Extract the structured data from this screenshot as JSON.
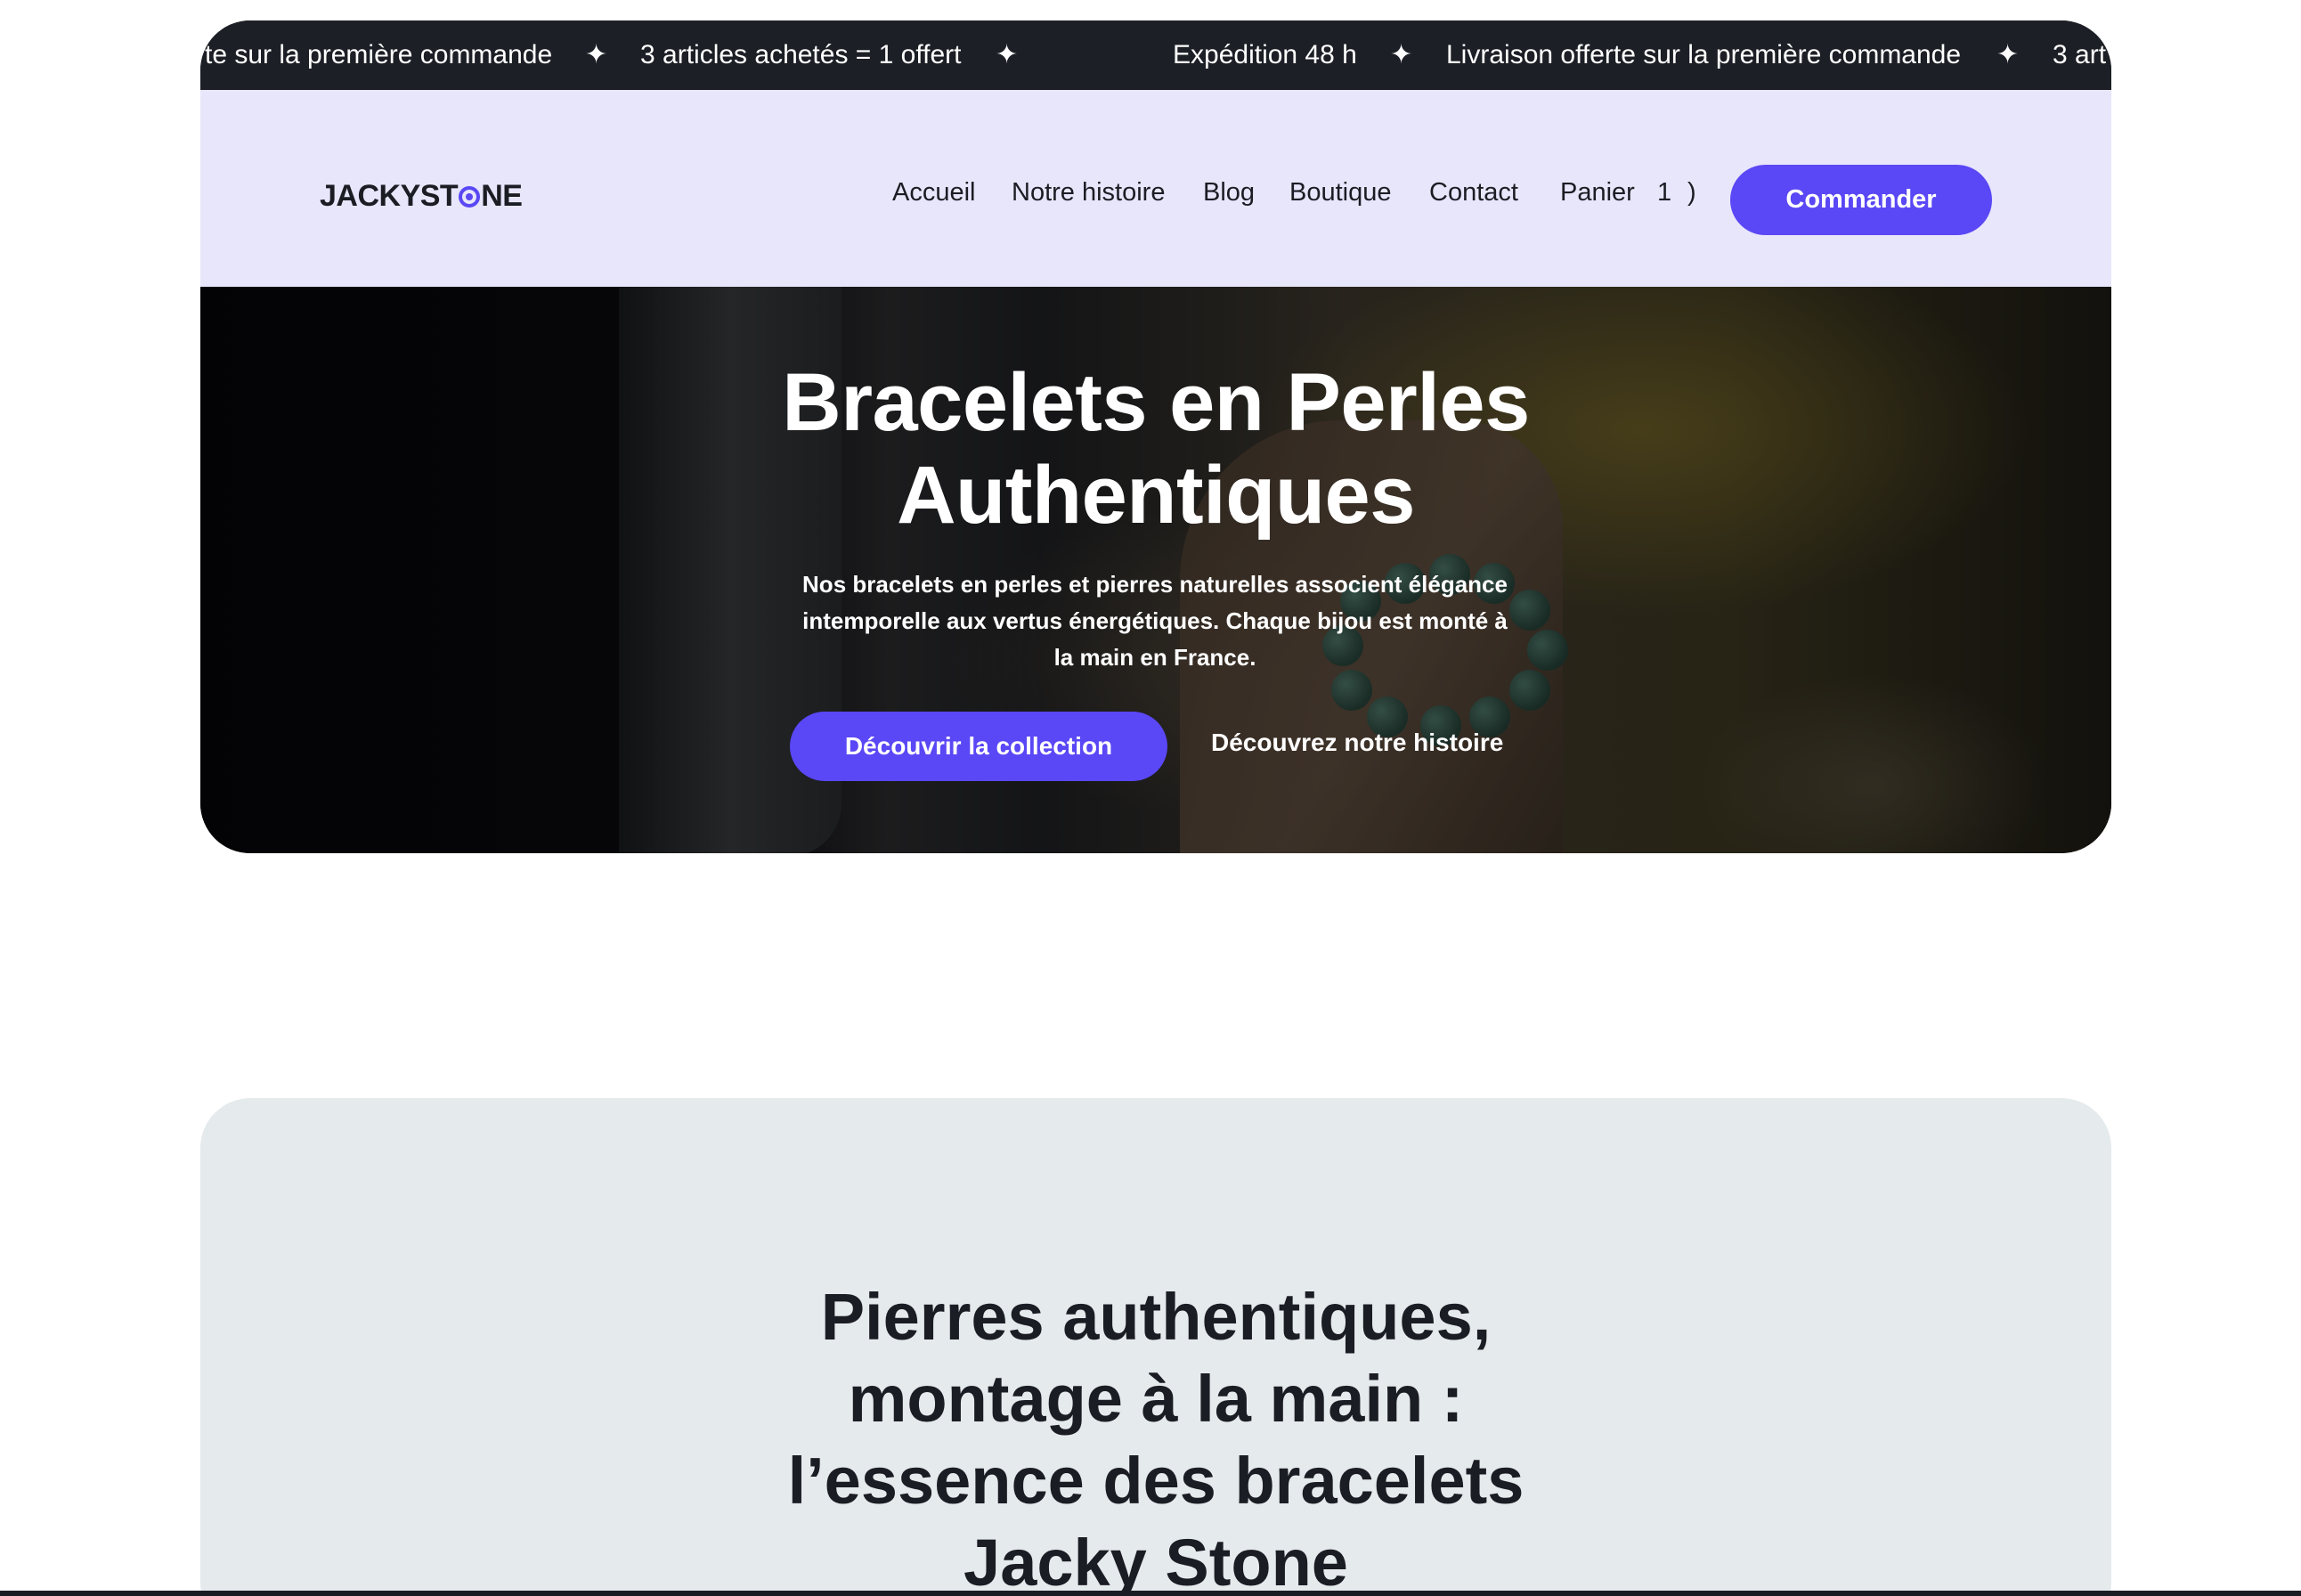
{
  "announcement": {
    "items": [
      "te sur la première commande",
      "3 articles achetés = 1 offert",
      "Expédition 48 h",
      "Livraison offerte sur la première commande",
      "3 art"
    ],
    "separator_icon": "sparkle-icon",
    "separator_glyph": "✦"
  },
  "header": {
    "logo_before": "JACKYST",
    "logo_after": "NE",
    "nav": [
      "Accueil",
      "Notre histoire",
      "Blog",
      "Boutique",
      "Contact",
      "Panier"
    ],
    "cart_count": "1",
    "cart_paren": ")",
    "cta_label": "Commander"
  },
  "hero": {
    "title_line1": "Bracelets en Perles",
    "title_line2": "Authentiques",
    "text_line1": "Nos bracelets en perles et pierres naturelles associent élégance",
    "text_line2": "intemporelle aux vertus énergétiques. Chaque bijou est monté à",
    "text_line3": "la main en France.",
    "primary_button": "Découvrir la collection",
    "secondary_link": "Découvrez notre histoire"
  },
  "section2": {
    "title_line1": "Pierres authentiques,",
    "title_line2": "montage à la main :",
    "title_line3": "l’essence des bracelets",
    "title_line4": "Jacky Stone"
  },
  "colors": {
    "accent": "#5a47f5",
    "header_bg": "#e7e6fb",
    "marquee_bg": "#1c1f25",
    "section_bg": "#e5eaec",
    "text_dark": "#1b1d24"
  }
}
